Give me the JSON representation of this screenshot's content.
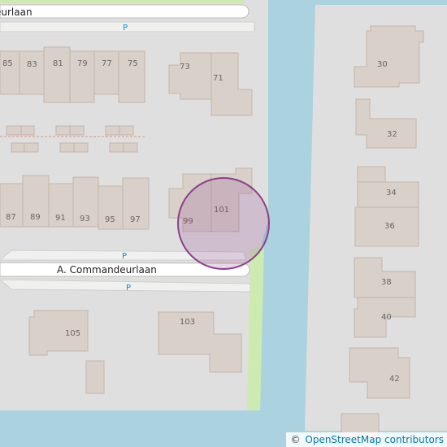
{
  "map": {
    "streets": {
      "top": "eurlaan",
      "main": "A. Commandeurlaan"
    },
    "parking_label": "P",
    "houses": {
      "h85": "85",
      "h83": "83",
      "h81": "81",
      "h79": "79",
      "h77": "77",
      "h75": "75",
      "h73": "73",
      "h71": "71",
      "h87": "87",
      "h89": "89",
      "h91": "91",
      "h93": "93",
      "h95": "95",
      "h97": "97",
      "h99": "99",
      "h101": "101",
      "h103": "103",
      "h105": "105",
      "h30": "30",
      "h32": "32",
      "h34": "34",
      "h36": "36",
      "h38": "38",
      "h40": "40",
      "h42": "42"
    },
    "colors": {
      "water": "#aad3df",
      "grass": "#cdebb0",
      "building": "#d9d0c9",
      "marker": "#8a3f8a"
    }
  },
  "attribution": {
    "symbol": "©",
    "link": "OpenStreetMap contributors"
  }
}
